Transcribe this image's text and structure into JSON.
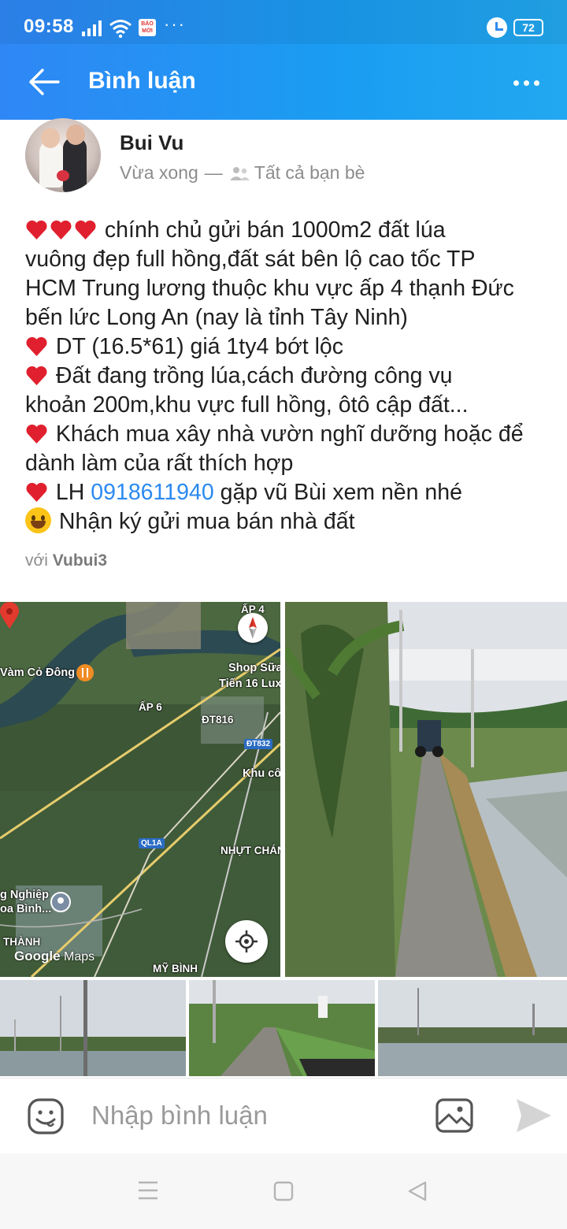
{
  "status_bar": {
    "time": "09:58",
    "notification_badge": "BÁO MỚI",
    "overflow": "···",
    "battery": "72"
  },
  "header": {
    "title": "Bình luận"
  },
  "post": {
    "author": "Bui Vu",
    "time": "Vừa xong",
    "separator": "—",
    "audience": "Tất cả bạn bè",
    "lines": [
      "chính chủ gửi bán 1000m2 đất lúa",
      "vuông đẹp full hồng,đất sát bên lộ cao tốc TP",
      "HCM Trung lương thuộc khu vực ấp 4 thạnh Đức",
      "bến lức Long An (nay là tỉnh Tây Ninh)",
      "DT (16.5*61) giá 1ty4 bớt lộc",
      "Đất đang trồng lúa,cách đường công vụ",
      "khoản 200m,khu vực full hồng, ôtô cập đất...",
      "Khách mua xây nhà vườn nghĩ dưỡng hoặc để",
      "dành làm của rất thích hợp",
      "LH ",
      "gặp vũ Bùi xem nền nhé",
      "Nhận ký gửi mua bán nhà đất"
    ],
    "phone": "0918611940",
    "with_prefix": "với",
    "with_user": "Vubui3"
  },
  "map": {
    "labels": {
      "ap4": "ẤP 4",
      "vam_co_dong": "Vàm Cỏ Đông",
      "shop": "Shop Sữa",
      "shop2": "Tiến 16 Lux",
      "ap6": "ẤP 6",
      "dt816": "ĐT816",
      "dt832": "ĐT832",
      "khu_co": "Khu cô",
      "ql1a": "QL1A",
      "nhut_chanh": "NHỰT CHÁNH",
      "nghiep": "g Nghiệp",
      "oa_binh": "oa Bình...",
      "thanh": "THÀNH",
      "my_binh": "MỸ BÌNH"
    },
    "google": "Google",
    "maps": "Maps"
  },
  "comment_bar": {
    "placeholder": "Nhập bình luận"
  },
  "colors": {
    "header": "#2f87f5",
    "link": "#2b8af0",
    "heart": "#e0202e"
  }
}
